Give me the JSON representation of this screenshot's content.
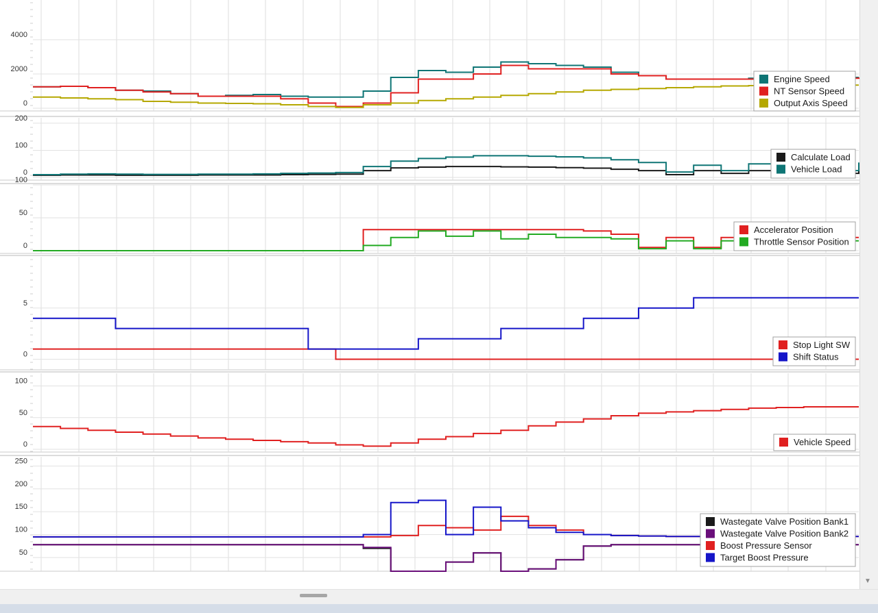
{
  "chart_data": [
    {
      "type": "line",
      "y_ticks": [
        "0",
        "2000",
        "4000"
      ],
      "ylim": [
        0,
        6000
      ],
      "grid": true,
      "legend": "right",
      "series": [
        {
          "name": "Engine Speed",
          "color": "#0e7575",
          "values": [
            1250,
            1280,
            1200,
            1050,
            1000,
            850,
            700,
            750,
            800,
            700,
            650,
            650,
            1000,
            1800,
            2200,
            2100,
            2400,
            2700,
            2600,
            2500,
            2400,
            2100,
            1900,
            1700,
            1700,
            1700,
            1750,
            1800,
            1750,
            1800,
            1800
          ]
        },
        {
          "name": "NT Sensor Speed",
          "color": "#e02020",
          "values": [
            1250,
            1280,
            1200,
            1050,
            950,
            850,
            700,
            700,
            700,
            550,
            300,
            100,
            300,
            900,
            1700,
            1700,
            2000,
            2500,
            2300,
            2300,
            2300,
            2000,
            1900,
            1700,
            1700,
            1700,
            1700,
            1750,
            1750,
            1750,
            1800
          ]
        },
        {
          "name": "Output Axis Speed",
          "color": "#b5a800",
          "values": [
            650,
            600,
            550,
            500,
            400,
            350,
            300,
            280,
            260,
            200,
            100,
            50,
            200,
            300,
            450,
            550,
            650,
            750,
            850,
            950,
            1050,
            1100,
            1150,
            1200,
            1250,
            1300,
            1320,
            1330,
            1340,
            1350,
            1350
          ]
        }
      ]
    },
    {
      "type": "line",
      "y_ticks": [
        "0",
        "100",
        "200"
      ],
      "ylim": [
        0,
        220
      ],
      "grid": true,
      "legend": "right",
      "series": [
        {
          "name": "Calculate Load",
          "color": "#1a1a1a",
          "values": [
            8,
            9,
            9,
            8,
            8,
            8,
            9,
            9,
            9,
            10,
            11,
            12,
            25,
            35,
            38,
            40,
            40,
            39,
            38,
            36,
            34,
            30,
            25,
            10,
            25,
            15,
            25,
            15,
            25,
            15,
            25
          ]
        },
        {
          "name": "Vehicle Load",
          "color": "#0e7575",
          "values": [
            10,
            12,
            13,
            12,
            11,
            11,
            12,
            12,
            13,
            15,
            16,
            18,
            40,
            60,
            70,
            75,
            80,
            80,
            78,
            76,
            72,
            65,
            55,
            20,
            45,
            25,
            50,
            25,
            50,
            25,
            55
          ]
        }
      ]
    },
    {
      "type": "line",
      "y_ticks": [
        "0",
        "50",
        "100"
      ],
      "ylim": [
        0,
        100
      ],
      "grid": true,
      "legend": "right",
      "series": [
        {
          "name": "Accelerator Position",
          "color": "#e02020",
          "values": [
            0,
            0,
            0,
            0,
            0,
            0,
            0,
            0,
            0,
            0,
            0,
            0,
            32,
            32,
            32,
            32,
            32,
            32,
            32,
            32,
            30,
            25,
            5,
            20,
            5,
            20,
            5,
            20,
            5,
            20,
            20
          ]
        },
        {
          "name": "Throttle Sensor Position",
          "color": "#22aa22",
          "values": [
            0,
            0,
            0,
            0,
            0,
            0,
            0,
            0,
            0,
            0,
            0,
            0,
            8,
            20,
            30,
            22,
            30,
            18,
            25,
            20,
            20,
            18,
            3,
            15,
            3,
            15,
            3,
            15,
            3,
            15,
            15
          ]
        }
      ]
    },
    {
      "type": "line",
      "y_ticks": [
        "0",
        "5"
      ],
      "ylim": [
        -0.5,
        10
      ],
      "grid": true,
      "legend": "right",
      "series": [
        {
          "name": "Stop Light SW",
          "color": "#e02020",
          "values": [
            1,
            1,
            1,
            1,
            1,
            1,
            1,
            1,
            1,
            1,
            1,
            0,
            0,
            0,
            0,
            0,
            0,
            0,
            0,
            0,
            0,
            0,
            0,
            0,
            0,
            0,
            0,
            0,
            0,
            0,
            0
          ]
        },
        {
          "name": "Shift Status",
          "color": "#1515c8",
          "values": [
            4,
            4,
            4,
            3,
            3,
            3,
            3,
            3,
            3,
            3,
            1,
            1,
            1,
            1,
            2,
            2,
            2,
            3,
            3,
            3,
            4,
            4,
            5,
            5,
            6,
            6,
            6,
            6,
            6,
            6,
            6
          ]
        }
      ]
    },
    {
      "type": "line",
      "y_ticks": [
        "0",
        "50",
        "100"
      ],
      "ylim": [
        0,
        120
      ],
      "grid": true,
      "legend": "right",
      "series": [
        {
          "name": "Vehicle Speed",
          "color": "#e02020",
          "values": [
            36,
            33,
            30,
            27,
            24,
            21,
            18,
            16,
            14,
            12,
            10,
            7,
            5,
            10,
            16,
            20,
            25,
            30,
            37,
            43,
            48,
            53,
            57,
            59,
            61,
            63,
            65,
            66,
            67,
            67,
            67
          ]
        }
      ]
    },
    {
      "type": "line",
      "y_ticks": [
        "50",
        "100",
        "150",
        "200",
        "250"
      ],
      "ylim": [
        20,
        270
      ],
      "grid": true,
      "legend": "right",
      "series": [
        {
          "name": "Wastegate Valve Position Bank1",
          "color": "#1a1a1a",
          "values": [
            78,
            78,
            78,
            78,
            78,
            78,
            78,
            78,
            78,
            78,
            78,
            78,
            70,
            20,
            20,
            40,
            60,
            20,
            25,
            45,
            75,
            78,
            78,
            78,
            78,
            78,
            78,
            78,
            78,
            78,
            78
          ]
        },
        {
          "name": "Wastegate Valve Position Bank2",
          "color": "#6a0f7a",
          "values": [
            78,
            78,
            78,
            78,
            78,
            78,
            78,
            78,
            78,
            78,
            78,
            78,
            72,
            20,
            20,
            40,
            60,
            20,
            25,
            45,
            75,
            78,
            78,
            78,
            78,
            78,
            78,
            78,
            78,
            78,
            78
          ]
        },
        {
          "name": "Boost Pressure Sensor",
          "color": "#e02020",
          "values": [
            95,
            95,
            95,
            95,
            95,
            95,
            95,
            95,
            95,
            95,
            95,
            95,
            95,
            98,
            120,
            115,
            110,
            140,
            120,
            110,
            100,
            98,
            97,
            96,
            96,
            96,
            96,
            96,
            96,
            96,
            96
          ]
        },
        {
          "name": "Target Boost Pressure",
          "color": "#1515c8",
          "values": [
            95,
            95,
            95,
            95,
            95,
            95,
            95,
            95,
            95,
            95,
            95,
            95,
            100,
            170,
            175,
            100,
            160,
            130,
            115,
            105,
            100,
            98,
            97,
            96,
            96,
            96,
            96,
            96,
            96,
            96,
            96
          ]
        }
      ]
    }
  ]
}
